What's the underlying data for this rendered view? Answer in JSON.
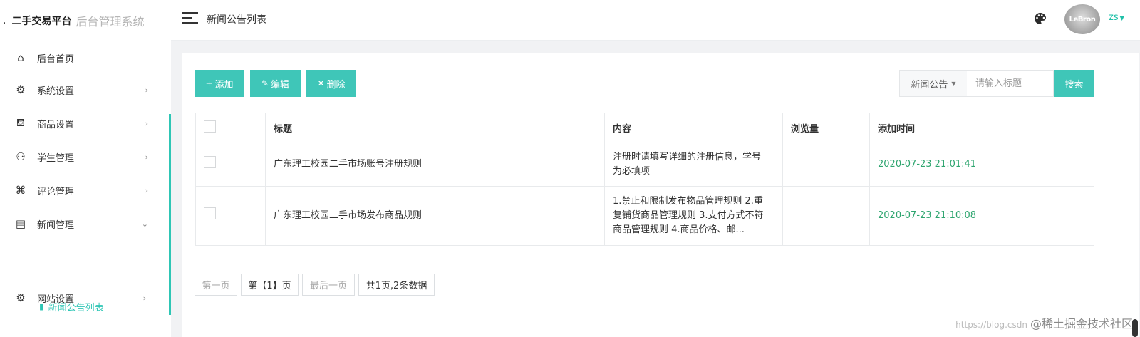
{
  "brand": {
    "dot": ".",
    "name": "二手交易平台",
    "subtitle": "后台管理系统"
  },
  "header": {
    "title": "新闻公告列表",
    "user": "zs",
    "avatar_text": "LeBron"
  },
  "sidebar": {
    "items": [
      {
        "label": "后台首页",
        "icon": "home-icon"
      },
      {
        "label": "系统设置",
        "icon": "gear-icon"
      },
      {
        "label": "商品设置",
        "icon": "basket-icon"
      },
      {
        "label": "学生管理",
        "icon": "people-icon"
      },
      {
        "label": "评论管理",
        "icon": "command-icon"
      },
      {
        "label": "新闻管理",
        "icon": "article-icon"
      },
      {
        "label": "网站设置",
        "icon": "gear-icon"
      }
    ],
    "active_sub": {
      "label": "新闻公告列表",
      "icon": "book-icon"
    }
  },
  "toolbar": {
    "add_label": "添加",
    "edit_label": "编辑",
    "delete_label": "删除",
    "search_select": "新闻公告",
    "search_placeholder": "请输入标题",
    "search_button": "搜索"
  },
  "table": {
    "headers": [
      "标题",
      "内容",
      "浏览量",
      "添加时间"
    ],
    "rows": [
      {
        "title": "广东理工校园二手市场账号注册规则",
        "content_lines": [
          "注册时请填写详细的注册信息，学号",
          "为必填项"
        ],
        "views": "",
        "time": "2020-07-23 21:01:41"
      },
      {
        "title": "广东理工校园二手市场发布商品规则",
        "content_lines": [
          "1.禁止和限制发布物品管理规则 2.重",
          "复铺货商品管理规则 3.支付方式不符",
          "商品管理规则 4.商品价格、邮..."
        ],
        "views": "",
        "time": "2020-07-23 21:10:08"
      }
    ]
  },
  "pager": {
    "first": "第一页",
    "current": "第【1】页",
    "last": "最后一页",
    "summary": "共1页,2条数据"
  },
  "watermark": {
    "url": "https://blog.csdn",
    "text": "@稀土掘金技术社区"
  },
  "colors": {
    "accent": "#3fc6b8",
    "time": "#2ea56f"
  }
}
